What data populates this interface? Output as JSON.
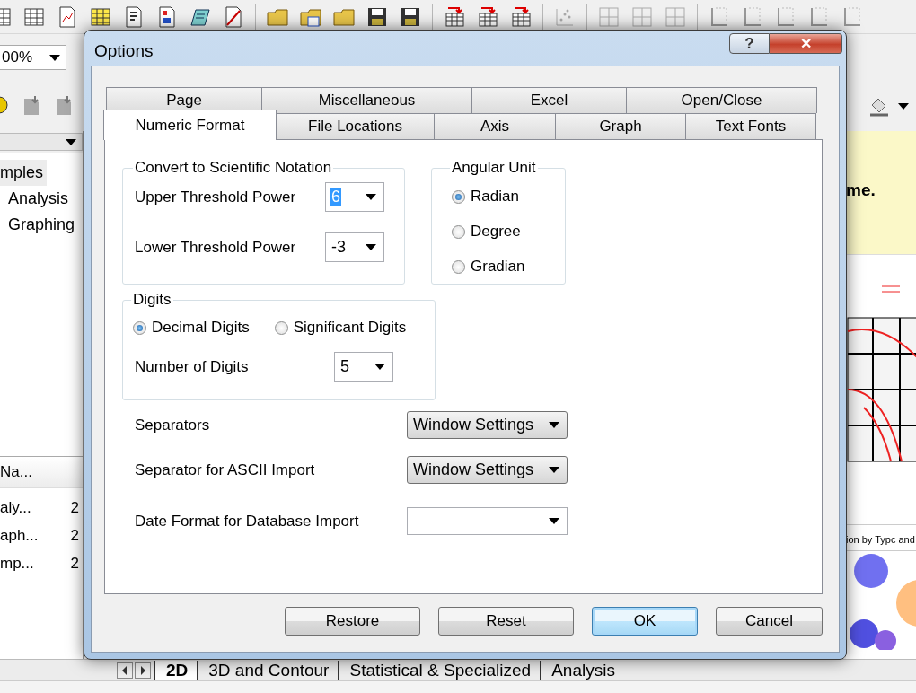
{
  "toolbar": {
    "zoom": "00%"
  },
  "sidebar": {
    "tree": [
      {
        "label": "mples",
        "selected": true,
        "children": [
          {
            "label": "Analysis",
            "selected": false
          },
          {
            "label": "Graphing",
            "selected": false
          }
        ]
      }
    ],
    "list": {
      "columns": [
        "Na..."
      ],
      "rows": [
        {
          "name": "aly...",
          "column_2": "2"
        },
        {
          "name": "aph...",
          "column_2": "2"
        },
        {
          "name": "mp...",
          "column_2": "2"
        }
      ]
    }
  },
  "preview": {
    "banner": "me.",
    "caption": "ion by Typc and"
  },
  "sheet_tabs": [
    {
      "label": "2D",
      "selected": true
    },
    {
      "label": "3D and Contour",
      "selected": false
    },
    {
      "label": "Statistical & Specialized",
      "selected": false
    },
    {
      "label": "Analysis",
      "selected": false
    }
  ],
  "dialog": {
    "title": "Options",
    "help_button": "?",
    "close_button": "✕",
    "tab_rows": [
      [
        {
          "label": "Page",
          "selected": false
        },
        {
          "label": "Miscellaneous",
          "selected": false
        },
        {
          "label": "Excel",
          "selected": false
        },
        {
          "label": "Open/Close",
          "selected": false
        }
      ],
      [
        {
          "label": "Numeric Format",
          "selected": true
        },
        {
          "label": "File Locations",
          "selected": false
        },
        {
          "label": "Axis",
          "selected": false
        },
        {
          "label": "Graph",
          "selected": false
        },
        {
          "label": "Text Fonts",
          "selected": false
        }
      ]
    ],
    "scientific": {
      "title": "Convert to Scientific Notation",
      "fields": [
        {
          "label": "Upper Threshold Power",
          "value": "6",
          "focused": true
        },
        {
          "label": "Lower Threshold Power",
          "value": "-3",
          "focused": false
        }
      ]
    },
    "angular_unit": {
      "title": "Angular Unit",
      "options": [
        {
          "label": "Radian",
          "selected": true
        },
        {
          "label": "Degree",
          "selected": false
        },
        {
          "label": "Gradian",
          "selected": false
        }
      ]
    },
    "digits": {
      "title": "Digits",
      "options": [
        {
          "label": "Decimal Digits",
          "selected": true
        },
        {
          "label": "Significant Digits",
          "selected": false
        }
      ],
      "field": {
        "label": "Number of Digits",
        "value": "5",
        "focused": false
      }
    },
    "settings": [
      {
        "label": "Separators",
        "value": "Window Settings",
        "kind": "button"
      },
      {
        "label": "Separator for ASCII Import",
        "value": "Window Settings",
        "kind": "button"
      },
      {
        "label": "Date Format for Database Import",
        "kind": "edit"
      }
    ],
    "buttons": [
      {
        "label": "Restore",
        "default": false
      },
      {
        "label": "Reset",
        "default": false
      },
      {
        "label": "OK",
        "default": true
      },
      {
        "label": "Cancel",
        "default": false
      }
    ]
  }
}
